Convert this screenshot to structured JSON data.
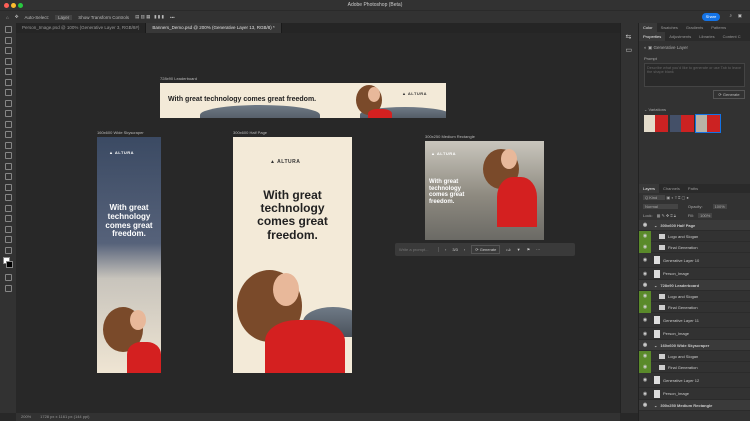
{
  "window": {
    "title": "Adobe Photoshop (Beta)"
  },
  "options": {
    "auto_select": "Auto-Select:",
    "layer_select": "Layer",
    "show_transform": "Show Transform Controls",
    "more": "•••",
    "share": "Share"
  },
  "tabs": [
    {
      "label": "Person_Image.psd @ 100% (Generative Layer 3, RGB/8#)"
    },
    {
      "label": "Banners_Demo.psd @ 200% (Generative Layer 13, RGB/8) *"
    }
  ],
  "artboards": {
    "leaderboard": {
      "label": "728x90 Leaderboard",
      "headline": "With great technology comes great freedom.",
      "logo": "ALTURA"
    },
    "skyscraper": {
      "label": "160x600 Wide Skyscraper",
      "headline": "With great technology comes great freedom.",
      "logo": "ALTURA"
    },
    "halfpage": {
      "label": "300x600 Half Page",
      "headline": "With great technology comes great freedom.",
      "logo": "ALTURA"
    },
    "medrect": {
      "label": "300x250 Medium Rectangle",
      "headline": "With great technology comes great freedom.",
      "logo": "ALTURA"
    }
  },
  "taskbar": {
    "placeholder": "Write a prompt...",
    "page": "3/3",
    "generate": "Generate"
  },
  "status": {
    "zoom": "200%",
    "size": "1728 px x 1161 px (144 ppi)"
  },
  "panel": {
    "top_tabs": [
      "Color",
      "Swatches",
      "Gradients",
      "Patterns"
    ],
    "prop_tabs": [
      "Properties",
      "Adjustments",
      "Libraries",
      "Content C"
    ],
    "layer_type": "Generative Layer",
    "prompt_label": "Prompt",
    "prompt_placeholder": "Describe what you'd like to generate or use Tab to leave the shape blank",
    "generate": "Generate",
    "variations": "Variations",
    "layer_tabs": [
      "Layers",
      "Channels",
      "Paths"
    ],
    "kind": "Q Kind",
    "blend": "Normal",
    "opacity_label": "Opacity:",
    "opacity": "100%",
    "lock_label": "Lock:",
    "fill_label": "Fill:",
    "fill": "100%",
    "layers": [
      {
        "name": "300x600 Half Page",
        "group": true
      },
      {
        "name": "Logo and Slogan",
        "folder": true,
        "green": true
      },
      {
        "name": "Final Generation",
        "folder": true,
        "green": true
      },
      {
        "name": "Generative Layer 10"
      },
      {
        "name": "Person_Image"
      },
      {
        "name": "728x90 Leaderboard",
        "group": true
      },
      {
        "name": "Logo and Slogan",
        "folder": true,
        "green": true
      },
      {
        "name": "Final Generation",
        "folder": true,
        "green": true
      },
      {
        "name": "Generative Layer 11"
      },
      {
        "name": "Person_Image"
      },
      {
        "name": "160x600 Wide Skyscraper",
        "group": true
      },
      {
        "name": "Logo and Slogan",
        "folder": true,
        "green": true
      },
      {
        "name": "Final Generation",
        "folder": true,
        "green": true
      },
      {
        "name": "Generative Layer 12"
      },
      {
        "name": "Person_Image"
      },
      {
        "name": "300x250 Medium Rectangle",
        "group": true
      }
    ]
  }
}
